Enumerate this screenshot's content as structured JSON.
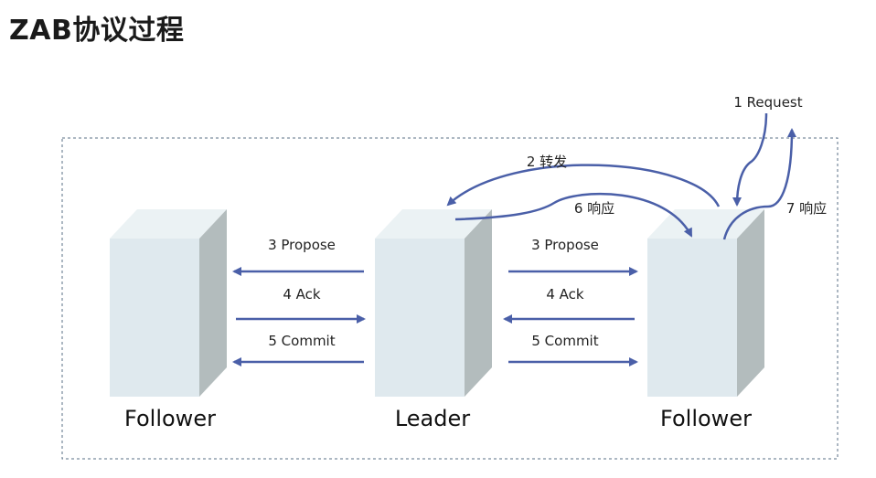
{
  "title": "ZAB协议过程",
  "nodes": {
    "left": "Follower",
    "center": "Leader",
    "right": "Follower"
  },
  "left_pair": {
    "propose": "3 Propose",
    "ack": "4 Ack",
    "commit": "5 Commit"
  },
  "right_pair": {
    "propose": "3 Propose",
    "ack": "4 Ack",
    "commit": "5 Commit"
  },
  "flow": {
    "request": "1 Request",
    "forward": "2 转发",
    "response_to_follower": "6 响应",
    "response_to_client": "7 响应"
  },
  "colors": {
    "arrow": "#4a5fa8",
    "box_front": "#dfe9ee",
    "box_top": "#ebf2f4",
    "box_side": "#b3bcbd",
    "border": "#5a6f86"
  }
}
